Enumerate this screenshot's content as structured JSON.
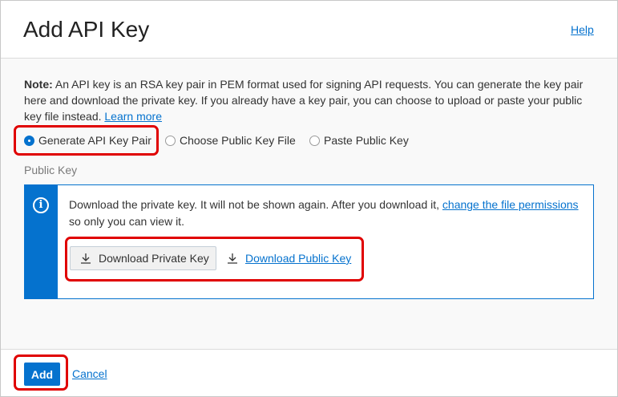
{
  "dialog": {
    "title": "Add API Key",
    "help_label": "Help"
  },
  "note": {
    "prefix": "Note:",
    "text": " An API key is an RSA key pair in PEM format used for signing API requests. You can generate the key pair here and download the private key. If you already have a key pair, you can choose to upload or paste your public key file instead. ",
    "learn_more": "Learn more"
  },
  "key_source": {
    "options": [
      {
        "label": "Generate API Key Pair",
        "checked": true
      },
      {
        "label": "Choose Public Key File",
        "checked": false
      },
      {
        "label": "Paste Public Key",
        "checked": false
      }
    ]
  },
  "public_key": {
    "section_label": "Public Key",
    "info_icon": "info-icon",
    "info_text_before": "Download the private key. It will not be shown again. After you download it, ",
    "info_link": "change the file permissions",
    "info_text_after": " so only you can view it.",
    "download_private_label": "Download Private Key",
    "download_public_label": "Download Public Key",
    "download_icon": "download-icon"
  },
  "footer": {
    "add_label": "Add",
    "cancel_label": "Cancel"
  },
  "colors": {
    "accent": "#0572ce",
    "highlight": "#e00000"
  }
}
